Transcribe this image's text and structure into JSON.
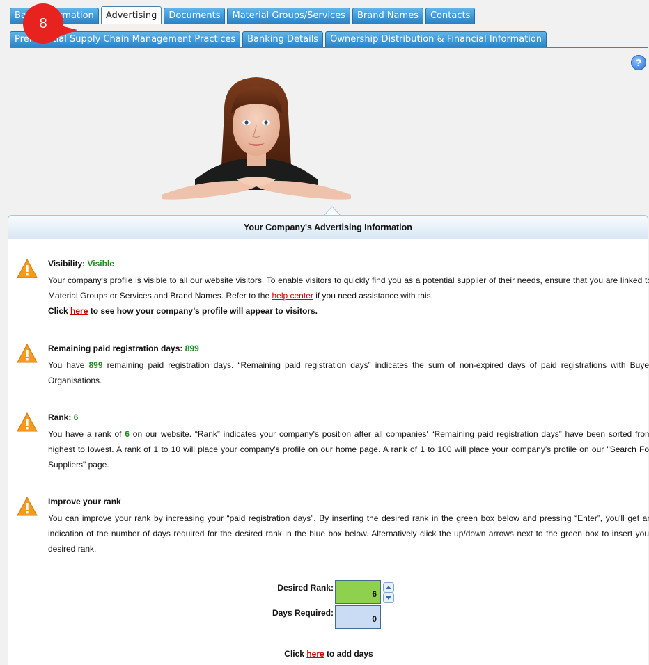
{
  "tabs_row1": [
    {
      "label": "Basic Information",
      "active": false
    },
    {
      "label": "Advertising",
      "active": true
    },
    {
      "label": "Documents",
      "active": false
    },
    {
      "label": "Material Groups/Services",
      "active": false
    },
    {
      "label": "Brand Names",
      "active": false
    },
    {
      "label": "Contacts",
      "active": false
    }
  ],
  "tabs_row2": [
    {
      "label": "Preferential Supply Chain Management Practices",
      "active": false
    },
    {
      "label": "Banking Details",
      "active": false
    },
    {
      "label": "Ownership Distribution & Financial Information",
      "active": false
    }
  ],
  "step_badge": "8",
  "help_glyph": "?",
  "panel": {
    "title": "Your Company's Advertising Information",
    "visibility": {
      "title_prefix": "Visibility: ",
      "status": "Visible",
      "text1": "Your company's profile is visible to all our website visitors. To enable visitors to quickly find you as a potential supplier of their needs, ensure that you are linked to Material Groups or Services and Brand Names. Refer to the ",
      "help_link": "help center",
      "text2": " if you need assistance with this.",
      "click_prefix": "Click ",
      "here_link": "here",
      "click_suffix": " to see how your company’s profile will appear to visitors."
    },
    "remaining": {
      "title_prefix": "Remaining paid registration days: ",
      "days": "899",
      "text1": "You have ",
      "text2": " remaining paid registration days. “Remaining paid registration days” indicates the sum of non-expired days of paid registrations with Buyer Organisations."
    },
    "rank": {
      "title_prefix": "Rank: ",
      "value": "6",
      "text1": "You have a rank of ",
      "text2": " on our website. “Rank” indicates your company's position after all companies' “Remaining paid registration days” have been sorted from highest to lowest. A rank of 1 to 10 will place your company's profile on our home page. A rank of 1 to 100 will place your company's profile on our \"Search For Suppliers\" page."
    },
    "improve": {
      "title": "Improve your rank",
      "text": "You can improve your rank by increasing your “paid registration days”. By inserting the desired rank in the green box below and pressing “Enter”, you'll get an indication of the number of days required for the desired rank in the blue box below. Alternatively click the up/down arrows next to the green box to insert your desired rank."
    },
    "desired_rank_label": "Desired Rank:",
    "desired_rank_value": "6",
    "days_required_label": "Days Required:",
    "days_required_value": "0",
    "add_prefix": "Click ",
    "add_link": "here",
    "add_suffix": " to add days"
  },
  "colors": {
    "tab_blue": "#2a82c6",
    "green_box": "#8fd14f",
    "blue_box": "#c9dcf3",
    "status_green": "#1e8c1e",
    "link_red": "#cc0000",
    "badge_red": "#e8231f"
  }
}
